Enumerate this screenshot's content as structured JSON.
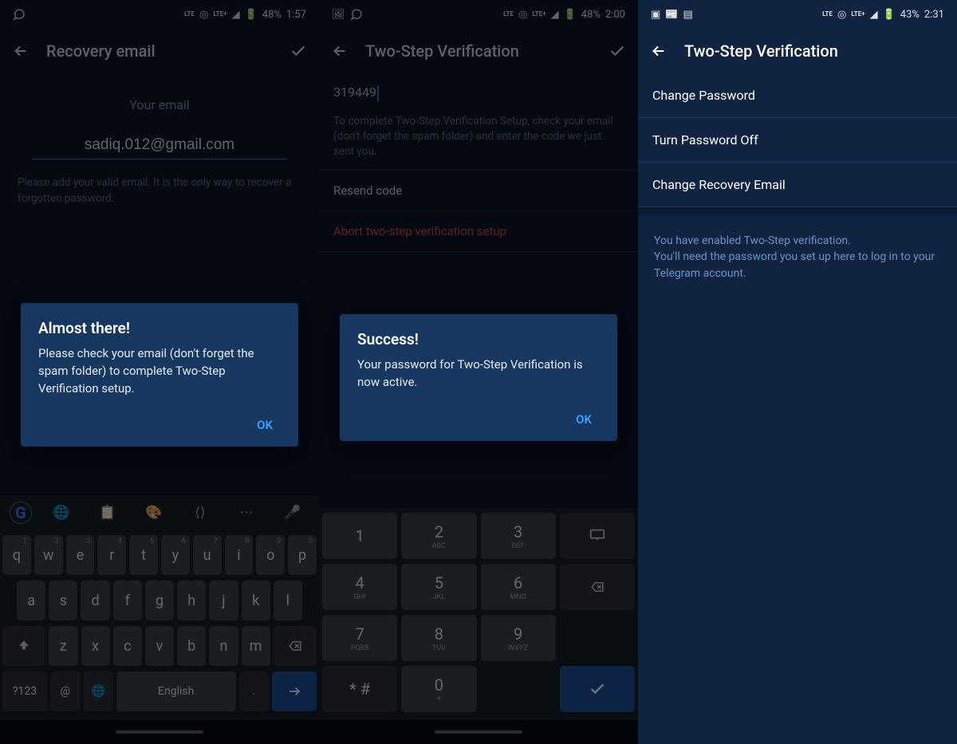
{
  "panel1": {
    "status": {
      "battery": "48%",
      "time": "1:57"
    },
    "appbar": {
      "title": "Recovery email"
    },
    "label": "Your email",
    "input_value": "sadiq.012@gmail.com",
    "help": "Please add your valid email. It is the only way to recover a forgotten password.",
    "dialog": {
      "title": "Almost there!",
      "body": "Please check your email (don't forget the spam folder) to complete Two-Step Verification setup.",
      "ok": "OK"
    },
    "keyboard": {
      "row1": [
        {
          "k": "q",
          "s": "1"
        },
        {
          "k": "w",
          "s": "2"
        },
        {
          "k": "e",
          "s": "3"
        },
        {
          "k": "r",
          "s": "4"
        },
        {
          "k": "t",
          "s": "5"
        },
        {
          "k": "y",
          "s": "6"
        },
        {
          "k": "u",
          "s": "7"
        },
        {
          "k": "i",
          "s": "8"
        },
        {
          "k": "o",
          "s": "9"
        },
        {
          "k": "p",
          "s": "0"
        }
      ],
      "row2": [
        "a",
        "s",
        "d",
        "f",
        "g",
        "h",
        "j",
        "k",
        "l"
      ],
      "row3": [
        "z",
        "x",
        "c",
        "v",
        "b",
        "n",
        "m"
      ],
      "sym": "?123",
      "lang": "English"
    }
  },
  "panel2": {
    "status": {
      "battery": "48%",
      "time": "2:00"
    },
    "appbar": {
      "title": "Two-Step Verification"
    },
    "code": "319449",
    "code_help": "To complete Two-Step Verification Setup, check your email (don't forget the spam folder) and enter the code we just sent you.",
    "resend": "Resend code",
    "abort": "Abort two-step verification setup",
    "dialog": {
      "title": "Success!",
      "body": "Your password for Two-Step Verification is now active.",
      "ok": "OK"
    },
    "numpad": {
      "keys": [
        [
          {
            "n": "1",
            "l": ""
          },
          {
            "n": "2",
            "l": "ABC"
          },
          {
            "n": "3",
            "l": "DEF"
          }
        ],
        [
          {
            "n": "4",
            "l": "GHI"
          },
          {
            "n": "5",
            "l": "JKL"
          },
          {
            "n": "6",
            "l": "MNO"
          }
        ],
        [
          {
            "n": "7",
            "l": "PQRS"
          },
          {
            "n": "8",
            "l": "TUV"
          },
          {
            "n": "9",
            "l": "WXYZ"
          }
        ]
      ],
      "sym": "* #",
      "zero": "0",
      "plus": "+"
    }
  },
  "panel3": {
    "status": {
      "battery": "43%",
      "time": "2:31"
    },
    "appbar": {
      "title": "Two-Step Verification"
    },
    "menu": [
      "Change Password",
      "Turn Password Off",
      "Change Recovery Email"
    ],
    "help": "You have enabled Two-Step verification.\nYou'll need the password you set up here to log in to your Telegram account."
  }
}
